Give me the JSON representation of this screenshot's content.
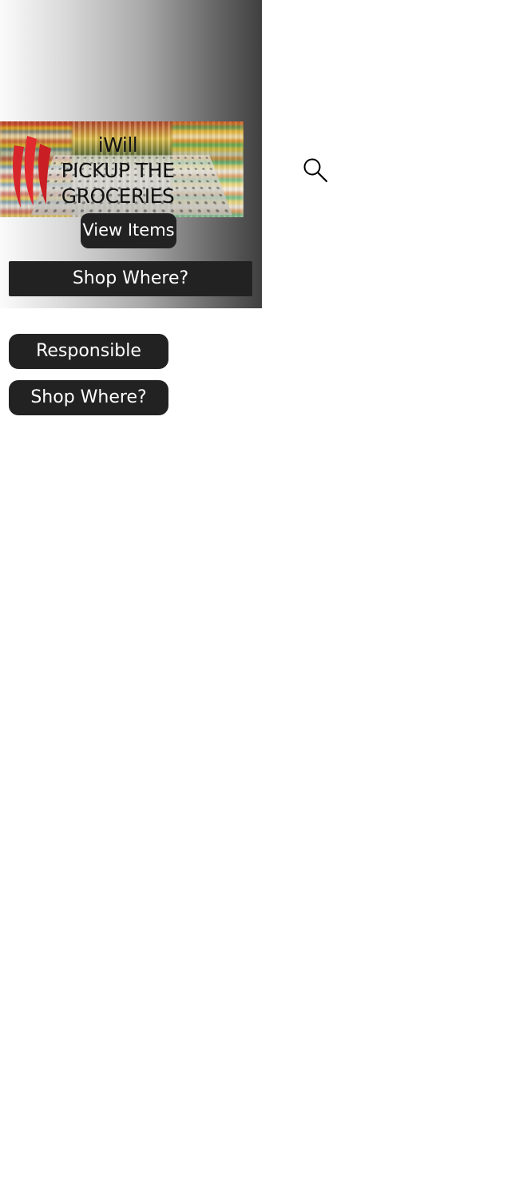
{
  "banner": {
    "title_lines": [
      "iWill",
      "PICKUP THE",
      "GROCERIES"
    ],
    "logo_icon": "red-stripes-logo",
    "image_icon": "shopping-cart-aisle-photo"
  },
  "buttons": {
    "view_items": "View Items",
    "shop_where_top": "Shop Where?",
    "responsible": "Responsible",
    "shop_where_bottom": "Shop Where?"
  },
  "icons": {
    "search": "search-icon"
  },
  "colors": {
    "button_bg": "#222222",
    "button_text": "#ffffff",
    "logo_red": "#d7262b"
  }
}
